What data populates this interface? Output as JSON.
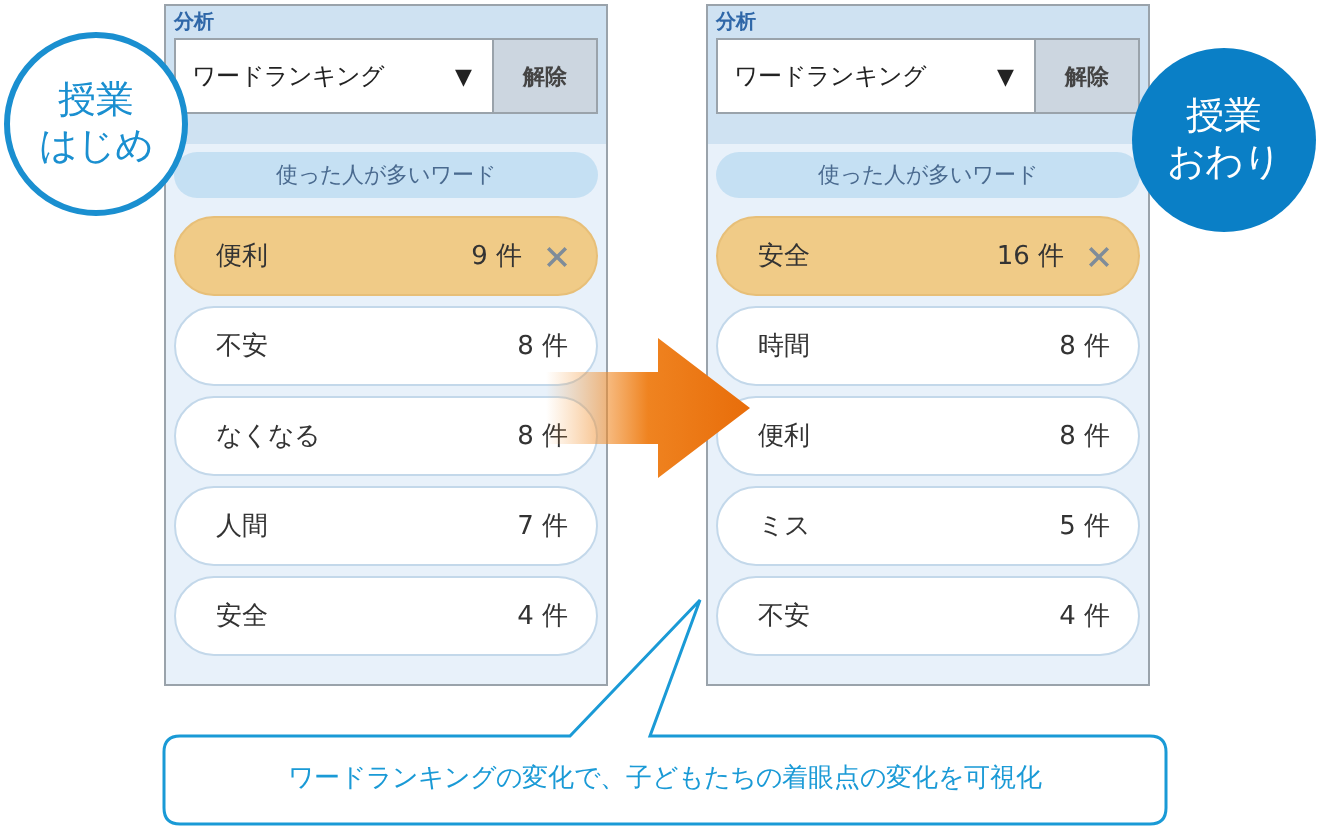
{
  "panels": [
    {
      "badge": {
        "kind": "outline",
        "lines": [
          "授業",
          "はじめ"
        ]
      },
      "section_label": "分析",
      "dropdown": {
        "value": "ワードランキング",
        "caret": "▼"
      },
      "clear_button": "解除",
      "list_heading": "使った人が多いワード",
      "words": [
        {
          "word": "便利",
          "count": "9 件",
          "selected": true
        },
        {
          "word": "不安",
          "count": "8 件",
          "selected": false
        },
        {
          "word": "なくなる",
          "count": "8 件",
          "selected": false
        },
        {
          "word": "人間",
          "count": "7 件",
          "selected": false
        },
        {
          "word": "安全",
          "count": "4 件",
          "selected": false
        }
      ]
    },
    {
      "badge": {
        "kind": "filled",
        "lines": [
          "授業",
          "おわり"
        ]
      },
      "section_label": "分析",
      "dropdown": {
        "value": "ワードランキング",
        "caret": "▼"
      },
      "clear_button": "解除",
      "list_heading": "使った人が多いワード",
      "words": [
        {
          "word": "安全",
          "count": "16 件",
          "selected": true
        },
        {
          "word": "時間",
          "count": "8 件",
          "selected": false
        },
        {
          "word": "便利",
          "count": "8 件",
          "selected": false
        },
        {
          "word": "ミス",
          "count": "5 件",
          "selected": false
        },
        {
          "word": "不安",
          "count": "4 件",
          "selected": false
        }
      ]
    }
  ],
  "callout": "ワードランキングの変化で、子どもたちの着眼点の変化を可視化"
}
